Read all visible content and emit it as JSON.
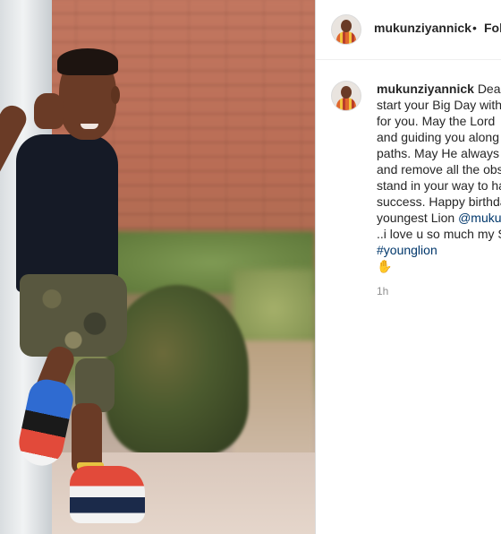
{
  "post": {
    "username": "mukunziyannick",
    "separator": "•",
    "follow_label": "Foll"
  },
  "caption": {
    "username": "mukunziyannick",
    "lines": [
      "Dear",
      "start your Big Day with",
      "for you. May the Lord",
      "and guiding you along",
      "paths. May He always",
      "and remove all the obs",
      "stand in your way to ha",
      "success. Happy birthda",
      "youngest Lion",
      "..i love u so much my S"
    ],
    "mention": "@muku",
    "hashtag": "#younglion",
    "emoji_icon": "raised-hand-emoji"
  },
  "timestamp": "1h"
}
